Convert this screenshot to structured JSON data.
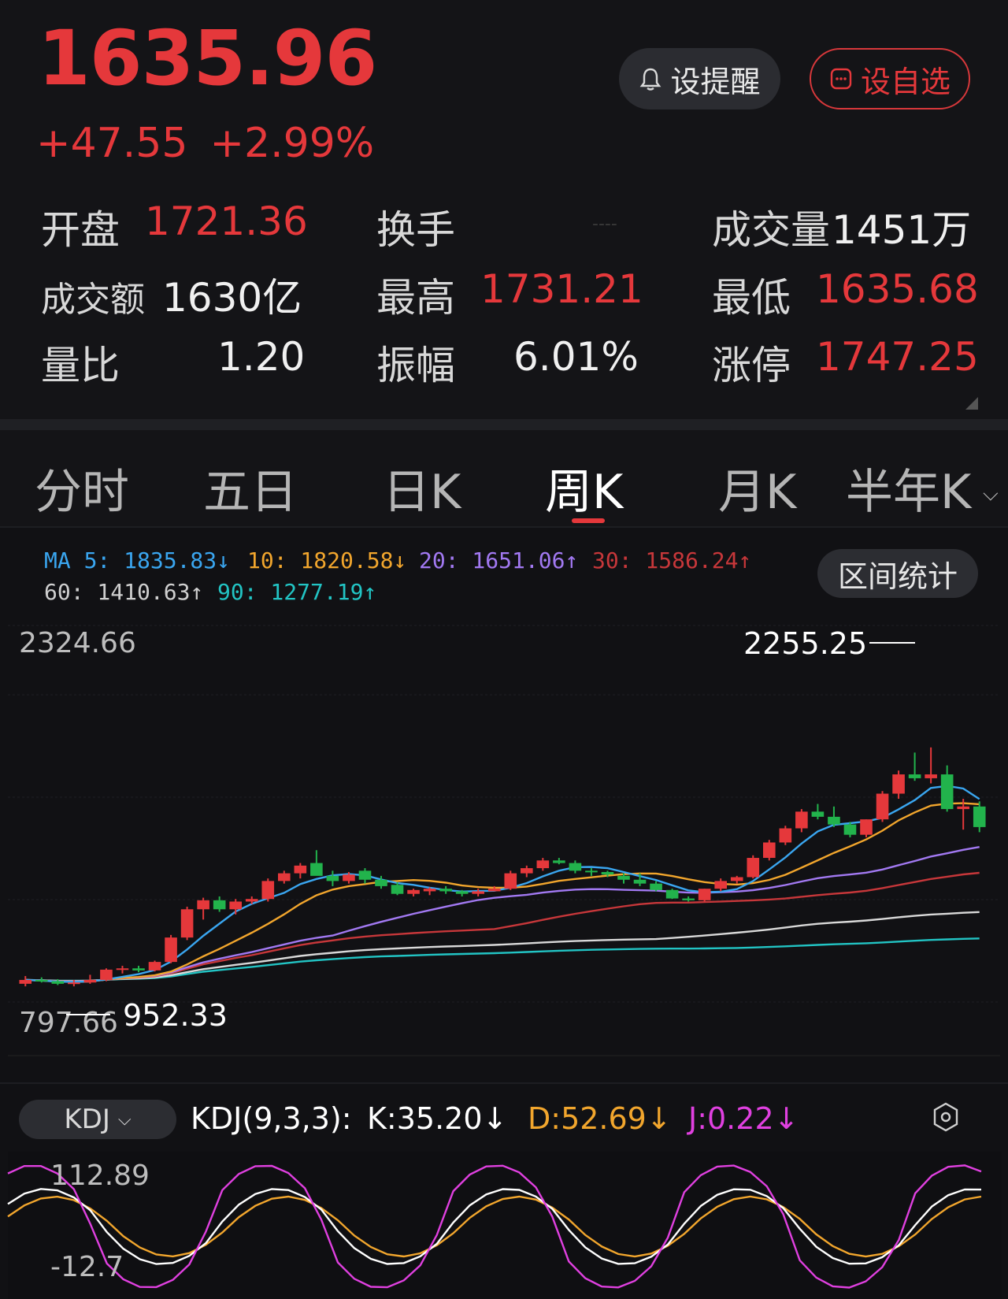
{
  "quote": {
    "price": "1635.96",
    "change": "+47.55",
    "change_pct": "+2.99%",
    "remind_label": "设提醒",
    "watch_label": "设自选",
    "stats": [
      {
        "label": "开盘",
        "value": "1721.36"
      },
      {
        "label": "换手",
        "value": "----"
      },
      {
        "label": "成交量",
        "value": "1451万"
      },
      {
        "label": "成交额",
        "value": "1630亿"
      },
      {
        "label": "最高",
        "value": "1731.21"
      },
      {
        "label": "最低",
        "value": "1635.68"
      },
      {
        "label": "量比",
        "value": "1.20"
      },
      {
        "label": "振幅",
        "value": "6.01%"
      },
      {
        "label": "涨停",
        "value": "1747.25"
      }
    ]
  },
  "tabs": [
    "分时",
    "五日",
    "日K",
    "周K",
    "月K",
    "半年K"
  ],
  "active_tab": "周K",
  "ma_legend": {
    "ma5": "MA 5: 1835.83↓",
    "ma10": "10: 1820.58↓",
    "ma20": "20: 1651.06↑",
    "ma30": "30: 1586.24↑",
    "ma60": "60: 1410.63↑",
    "ma90": "90: 1277.19↑"
  },
  "range_stats_label": "区间统计",
  "chart_data": {
    "type": "candlestick",
    "y_axis": {
      "max_label": "2324.66",
      "min_label": "797.66"
    },
    "annotations": {
      "high": "2255.25",
      "low": "952.33"
    },
    "colors": {
      "up": "#e5383b",
      "down": "#22b34c",
      "ma5": "#3aa6f0",
      "ma10": "#f2a62d",
      "ma20": "#a279f2",
      "ma30": "#c7373a",
      "ma60": "#d9d9d9",
      "ma90": "#22c4c4"
    },
    "candles": [
      [
        930,
        960,
        920,
        945
      ],
      [
        945,
        955,
        935,
        940
      ],
      [
        940,
        948,
        925,
        930
      ],
      [
        930,
        945,
        920,
        935
      ],
      [
        935,
        965,
        930,
        945
      ],
      [
        945,
        990,
        940,
        985
      ],
      [
        985,
        1000,
        970,
        990
      ],
      [
        990,
        1000,
        975,
        982
      ],
      [
        982,
        1020,
        978,
        1015
      ],
      [
        1015,
        1120,
        1010,
        1110
      ],
      [
        1110,
        1230,
        1100,
        1220
      ],
      [
        1220,
        1265,
        1180,
        1255
      ],
      [
        1255,
        1270,
        1210,
        1220
      ],
      [
        1220,
        1260,
        1200,
        1250
      ],
      [
        1250,
        1270,
        1240,
        1260
      ],
      [
        1260,
        1340,
        1250,
        1330
      ],
      [
        1330,
        1370,
        1320,
        1360
      ],
      [
        1360,
        1400,
        1340,
        1390
      ],
      [
        1400,
        1450,
        1360,
        1350
      ],
      [
        1350,
        1370,
        1310,
        1330
      ],
      [
        1330,
        1365,
        1320,
        1355
      ],
      [
        1370,
        1380,
        1320,
        1335
      ],
      [
        1335,
        1350,
        1300,
        1310
      ],
      [
        1315,
        1325,
        1275,
        1280
      ],
      [
        1280,
        1300,
        1270,
        1295
      ],
      [
        1290,
        1305,
        1275,
        1300
      ],
      [
        1300,
        1310,
        1280,
        1290
      ],
      [
        1290,
        1295,
        1270,
        1280
      ],
      [
        1280,
        1300,
        1270,
        1290
      ],
      [
        1290,
        1310,
        1290,
        1300
      ],
      [
        1300,
        1370,
        1295,
        1360
      ],
      [
        1360,
        1390,
        1345,
        1380
      ],
      [
        1380,
        1420,
        1370,
        1410
      ],
      [
        1410,
        1420,
        1395,
        1400
      ],
      [
        1400,
        1410,
        1360,
        1370
      ],
      [
        1370,
        1380,
        1350,
        1365
      ],
      [
        1365,
        1370,
        1345,
        1355
      ],
      [
        1350,
        1360,
        1320,
        1335
      ],
      [
        1335,
        1360,
        1310,
        1320
      ],
      [
        1320,
        1330,
        1290,
        1295
      ],
      [
        1295,
        1300,
        1260,
        1262
      ],
      [
        1262,
        1270,
        1250,
        1255
      ],
      [
        1255,
        1300,
        1250,
        1300
      ],
      [
        1300,
        1340,
        1290,
        1330
      ],
      [
        1330,
        1350,
        1320,
        1345
      ],
      [
        1345,
        1430,
        1340,
        1420
      ],
      [
        1420,
        1490,
        1410,
        1480
      ],
      [
        1480,
        1545,
        1470,
        1535
      ],
      [
        1535,
        1610,
        1520,
        1600
      ],
      [
        1600,
        1630,
        1570,
        1580
      ],
      [
        1580,
        1620,
        1540,
        1550
      ],
      [
        1550,
        1560,
        1500,
        1510
      ],
      [
        1510,
        1570,
        1500,
        1570
      ],
      [
        1570,
        1680,
        1560,
        1670
      ],
      [
        1670,
        1760,
        1650,
        1745
      ],
      [
        1745,
        1830,
        1720,
        1730
      ],
      [
        1730,
        1850,
        1710,
        1745
      ],
      [
        1745,
        1780,
        1600,
        1610
      ],
      [
        1610,
        1650,
        1530,
        1620
      ],
      [
        1620,
        1640,
        1520,
        1540
      ]
    ]
  },
  "kdj": {
    "selector": "KDJ",
    "title": "KDJ(9,3,3):",
    "k": "K:35.20↓",
    "d": "D:52.69↓",
    "j": "J:0.22↓",
    "y_max": "112.89",
    "y_min": "-12.7"
  }
}
